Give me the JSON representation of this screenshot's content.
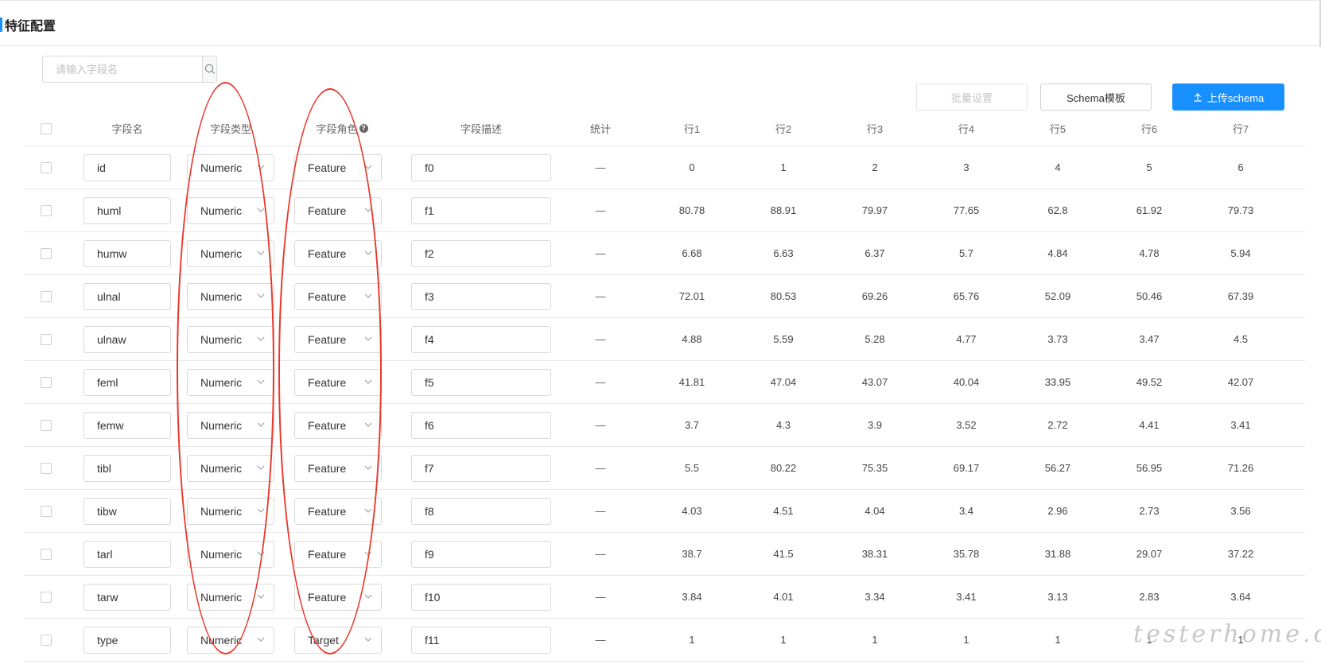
{
  "page": {
    "title": "特征配置"
  },
  "search": {
    "placeholder": "请输入字段名"
  },
  "actions": {
    "batch_label": "批量设置",
    "schema_template_label": "Schema模板",
    "upload_label": "上传schema"
  },
  "table": {
    "headers": {
      "field_name": "字段名",
      "field_type": "字段类型",
      "field_role": "字段角色",
      "field_desc": "字段描述",
      "stats": "统计",
      "rows": [
        "行1",
        "行2",
        "行3",
        "行4",
        "行5",
        "行6",
        "行7"
      ]
    },
    "rows": [
      {
        "name": "id",
        "type": "Numeric",
        "role": "Feature",
        "desc": "f0",
        "stats": "—",
        "values": [
          "0",
          "1",
          "2",
          "3",
          "4",
          "5",
          "6"
        ]
      },
      {
        "name": "huml",
        "type": "Numeric",
        "role": "Feature",
        "desc": "f1",
        "stats": "—",
        "values": [
          "80.78",
          "88.91",
          "79.97",
          "77.65",
          "62.8",
          "61.92",
          "79.73"
        ]
      },
      {
        "name": "humw",
        "type": "Numeric",
        "role": "Feature",
        "desc": "f2",
        "stats": "—",
        "values": [
          "6.68",
          "6.63",
          "6.37",
          "5.7",
          "4.84",
          "4.78",
          "5.94"
        ]
      },
      {
        "name": "ulnal",
        "type": "Numeric",
        "role": "Feature",
        "desc": "f3",
        "stats": "—",
        "values": [
          "72.01",
          "80.53",
          "69.26",
          "65.76",
          "52.09",
          "50.46",
          "67.39"
        ]
      },
      {
        "name": "ulnaw",
        "type": "Numeric",
        "role": "Feature",
        "desc": "f4",
        "stats": "—",
        "values": [
          "4.88",
          "5.59",
          "5.28",
          "4.77",
          "3.73",
          "3.47",
          "4.5"
        ]
      },
      {
        "name": "feml",
        "type": "Numeric",
        "role": "Feature",
        "desc": "f5",
        "stats": "—",
        "values": [
          "41.81",
          "47.04",
          "43.07",
          "40.04",
          "33.95",
          "49.52",
          "42.07"
        ]
      },
      {
        "name": "femw",
        "type": "Numeric",
        "role": "Feature",
        "desc": "f6",
        "stats": "—",
        "values": [
          "3.7",
          "4.3",
          "3.9",
          "3.52",
          "2.72",
          "4.41",
          "3.41"
        ]
      },
      {
        "name": "tibl",
        "type": "Numeric",
        "role": "Feature",
        "desc": "f7",
        "stats": "—",
        "values": [
          "5.5",
          "80.22",
          "75.35",
          "69.17",
          "56.27",
          "56.95",
          "71.26"
        ]
      },
      {
        "name": "tibw",
        "type": "Numeric",
        "role": "Feature",
        "desc": "f8",
        "stats": "—",
        "values": [
          "4.03",
          "4.51",
          "4.04",
          "3.4",
          "2.96",
          "2.73",
          "3.56"
        ]
      },
      {
        "name": "tarl",
        "type": "Numeric",
        "role": "Feature",
        "desc": "f9",
        "stats": "—",
        "values": [
          "38.7",
          "41.5",
          "38.31",
          "35.78",
          "31.88",
          "29.07",
          "37.22"
        ]
      },
      {
        "name": "tarw",
        "type": "Numeric",
        "role": "Feature",
        "desc": "f10",
        "stats": "—",
        "values": [
          "3.84",
          "4.01",
          "3.34",
          "3.41",
          "3.13",
          "2.83",
          "3.64"
        ]
      },
      {
        "name": "type",
        "type": "Numeric",
        "role": "Target",
        "desc": "f11",
        "stats": "—",
        "values": [
          "1",
          "1",
          "1",
          "1",
          "1",
          "1",
          "1"
        ]
      }
    ]
  },
  "watermark": "testerhome.com",
  "colors": {
    "accent": "#1890ff",
    "annotation": "#e8382b"
  }
}
